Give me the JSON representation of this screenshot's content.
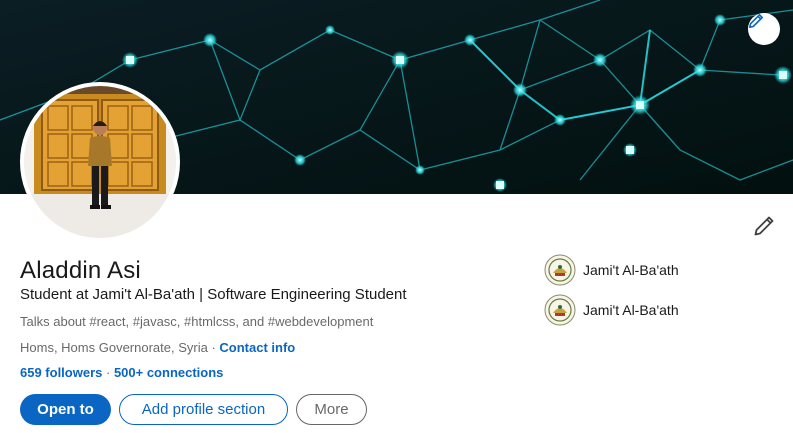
{
  "profile": {
    "name": "Aladdin Asi",
    "headline": "Student at Jami't Al-Ba'ath | Software Engineering Student",
    "talks_about": "Talks about #react, #javasc, #htmlcss, and #webdevelopment",
    "location": "Homs, Homs Governorate, Syria",
    "location_sep": " · ",
    "contact_info": "Contact info",
    "followers": "659 followers",
    "network_sep": " · ",
    "connections": "500+ connections"
  },
  "actions": {
    "open_to": "Open to",
    "add_section": "Add profile section",
    "more": "More"
  },
  "education": [
    {
      "name": "Jami't Al-Ba'ath"
    },
    {
      "name": "Jami't Al-Ba'ath"
    }
  ],
  "icons": {
    "banner_edit": "pencil-icon",
    "profile_edit": "pencil-icon",
    "school_logo": "university-seal"
  },
  "colors": {
    "accent": "#0a66c2",
    "banner_bg": "#03141a",
    "network_cyan": "#2de3e8"
  }
}
